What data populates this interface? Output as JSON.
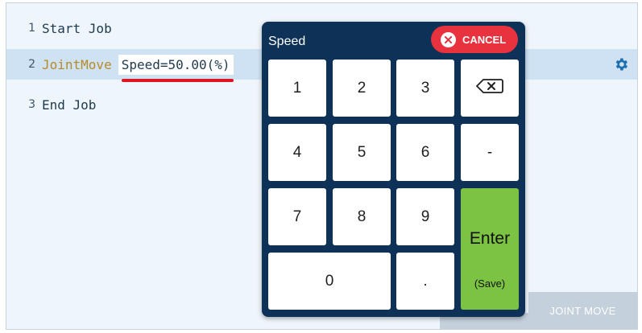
{
  "editor": {
    "lines": [
      {
        "number": "1",
        "command": "Start Job"
      },
      {
        "number": "2",
        "command": "JointMove",
        "param": "Speed=50.00(%)"
      },
      {
        "number": "3",
        "command": "End Job"
      }
    ],
    "settings_icon": "gear-icon"
  },
  "bottom_button": {
    "label": "JOINT MOVE"
  },
  "keypad": {
    "title": "Speed",
    "cancel_label": "CANCEL",
    "keys": {
      "k1": "1",
      "k2": "2",
      "k3": "3",
      "k4": "4",
      "k5": "5",
      "k6": "6",
      "k7": "7",
      "k8": "8",
      "k9": "9",
      "k0": "0",
      "minus": "-",
      "dot": ".",
      "backspace_icon": "backspace-icon"
    },
    "enter_label": "Enter",
    "enter_sub": "(Save)"
  },
  "colors": {
    "panel": "#0e3158",
    "cancel": "#e8323e",
    "enter": "#7cc243",
    "highlight_row": "#cfe2f3",
    "underline": "#e0141e",
    "keyword": "#b58b2a"
  }
}
